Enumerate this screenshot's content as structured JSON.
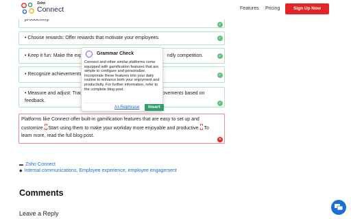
{
  "header": {
    "logo_small": "Zoho",
    "logo_big": "Connect",
    "nav_features": "Features",
    "nav_pricing": "Pricing",
    "signup": "Sign Up Now"
  },
  "items": [
    {
      "lead": "",
      "text": "productivity."
    },
    {
      "lead": "Choose rewards:",
      "text": " Offer rewards that motivate your employees."
    },
    {
      "lead": "Keep it fun:",
      "text": " Make the expe",
      "tail": "ndly competition."
    },
    {
      "lead": "Recognize achievements:",
      "text": ""
    },
    {
      "lead": "Measure and adjust:",
      "text": " Track",
      "tail": "rovements based on feedback."
    }
  ],
  "popup": {
    "title": "Grammar Check",
    "text": "Connect and other similar platforms come equipped with gamification features that are simple to configure and personalize. Incorporate these features into your daily routine to enhance both your enjoyment and productivity. For further information, refer to the complete blog post.",
    "rephrase": "AI-Rephrase",
    "insert": "Insert"
  },
  "red_paragraph": {
    "part1": "Platforms like Connect offer built-in gamification features that are easy to set up and customize.",
    "part2": "Start using them to make your workday more enjoyable and productive.",
    "part3": "To learn more, read the full blog post."
  },
  "meta": {
    "category": "Zoho Connect",
    "tags": "Internal communications, Employee experience, employee engagement"
  },
  "comments_title": "Comments",
  "leave_reply": "Leave a Reply",
  "colors": {
    "accent_red": "#e42527",
    "link_blue": "#1a6fd1",
    "check_green": "#63c27f",
    "insert_green": "#2f9e6e"
  }
}
